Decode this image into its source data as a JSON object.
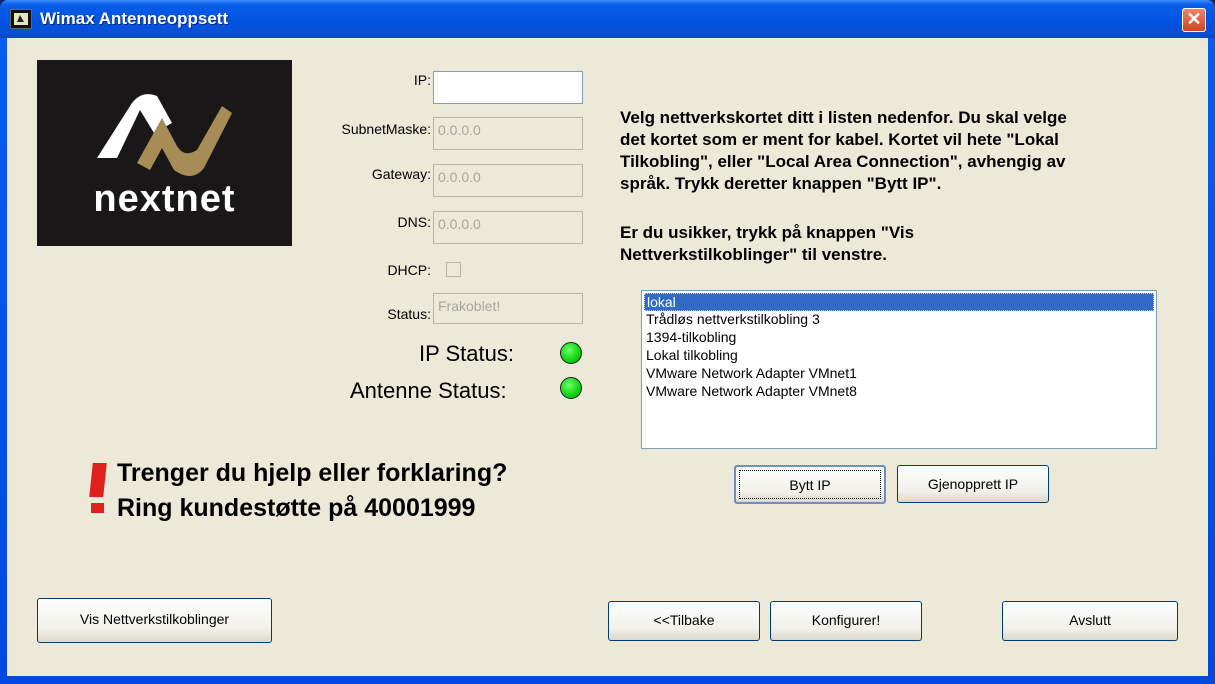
{
  "window": {
    "title": "Wimax Antenneoppsett",
    "close_glyph": "✕"
  },
  "logo": {
    "text": "nextnet"
  },
  "fields": {
    "ip": {
      "label": "IP:",
      "value": ""
    },
    "subnet": {
      "label": "SubnetMaske:",
      "value": "0.0.0.0"
    },
    "gateway": {
      "label": "Gateway:",
      "value": "0.0.0.0"
    },
    "dns": {
      "label": "DNS:",
      "value": "0.0.0.0"
    },
    "dhcp": {
      "label": "DHCP:",
      "checked": false
    },
    "status": {
      "label": "Status:",
      "value": "Frakoblet!"
    }
  },
  "indicators": {
    "ip_status": {
      "label": "IP Status:",
      "color": "#14d614"
    },
    "antenne_status": {
      "label": "Antenne Status:",
      "color": "#14d614"
    }
  },
  "help": {
    "line1": "Trenger du hjelp eller forklaring?",
    "line2": "Ring kundestøtte på 40001999"
  },
  "instructions": {
    "p1": "Velg nettverkskortet ditt i listen nedenfor. Du skal velge\ndet kortet som er ment for kabel. Kortet vil hete \"Lokal\nTilkobling\", eller \"Local Area Connection\", avhengig av\nspråk. Trykk deretter knappen \"Bytt IP\".",
    "p2": "Er du usikker, trykk på  knappen \"Vis\nNettverkstilkoblinger\" til venstre."
  },
  "adapters": {
    "selected": "lokal",
    "items": [
      "lokal",
      "Trådløs nettverkstilkobling 3",
      "1394-tilkobling",
      "Lokal tilkobling",
      "VMware Network Adapter VMnet1",
      "VMware Network Adapter VMnet8"
    ]
  },
  "buttons": {
    "bytt_ip": "Bytt  IP",
    "gjenopprett_ip": "Gjenopprett IP",
    "vis_nettverk": "Vis Nettverkstilkoblinger",
    "tilbake": "<<Tilbake",
    "konfigurer": "Konfigurer!",
    "avslutt": "Avslutt"
  },
  "colors": {
    "accent": "#0054e3",
    "selection": "#316ac5",
    "help_mark": "#e0201c"
  }
}
